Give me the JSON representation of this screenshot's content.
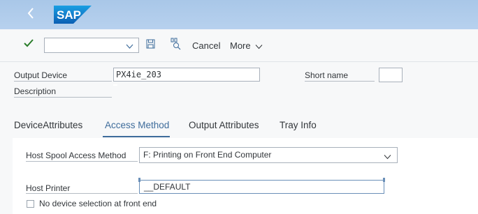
{
  "header": {
    "logo_text": "SAP"
  },
  "toolbar": {
    "command_field_value": "",
    "cancel_label": "Cancel",
    "more_label": "More"
  },
  "form": {
    "output_device_label": "Output Device",
    "output_device_value": "PX4ie_203",
    "short_name_label": "Short name",
    "short_name_value": "",
    "description_label": "Description",
    "description_value": ""
  },
  "tabs": [
    {
      "label": "DeviceAttributes",
      "active": false
    },
    {
      "label": "Access Method",
      "active": true
    },
    {
      "label": "Output Attributes",
      "active": false
    },
    {
      "label": "Tray Info",
      "active": false
    }
  ],
  "access_method": {
    "host_spool_label": "Host Spool Access Method",
    "host_spool_value": "F: Printing on Front End Computer",
    "host_printer_label": "Host Printer",
    "host_printer_value": "__DEFAULT",
    "no_device_selection_label": "No device selection at front end",
    "no_device_selection_checked": false
  },
  "colors": {
    "shellbar": "#b7d1ee",
    "accent": "#3e6c9b",
    "check_green": "#2b7d2b"
  }
}
